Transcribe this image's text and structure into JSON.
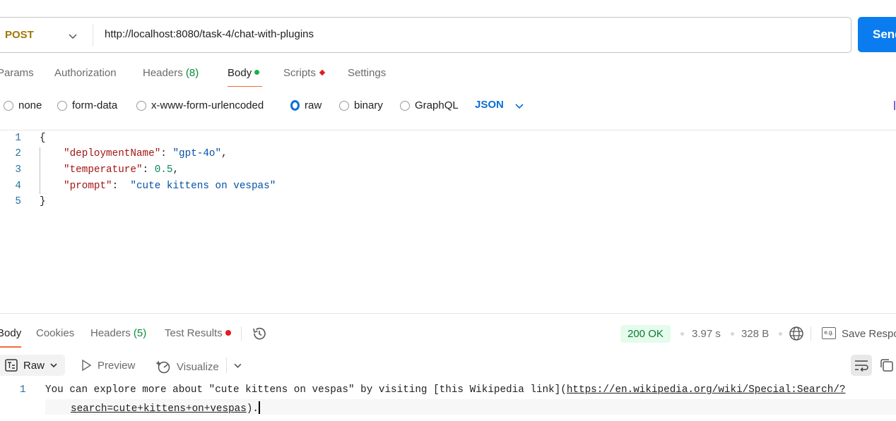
{
  "request": {
    "method": "POST",
    "url": "http://localhost:8080/task-4/chat-with-plugins",
    "send_label": "Send",
    "tabs": [
      {
        "label": "Params"
      },
      {
        "label": "Authorization"
      },
      {
        "label": "Headers",
        "count": "(8)"
      },
      {
        "label": "Body",
        "active": true,
        "indicator": "green-dot"
      },
      {
        "label": "Scripts",
        "indicator": "red-diamond"
      },
      {
        "label": "Settings"
      }
    ],
    "body_types": [
      "none",
      "form-data",
      "x-www-form-urlencoded",
      "raw",
      "binary",
      "GraphQL"
    ],
    "selected_body_type": "raw",
    "language": "JSON",
    "code_lines": [
      {
        "n": "1",
        "text": "{"
      },
      {
        "n": "2",
        "key": "\"deploymentName\"",
        "sep": ": ",
        "value": "\"gpt-4o\"",
        "tail": ","
      },
      {
        "n": "3",
        "key": "\"temperature\"",
        "sep": ": ",
        "value": "0.5",
        "tail": ","
      },
      {
        "n": "4",
        "key": "\"prompt\"",
        "sep": ":  ",
        "value": "\"cute kittens on vespas\"",
        "tail": ""
      },
      {
        "n": "5",
        "text": "}"
      }
    ]
  },
  "response": {
    "tabs": [
      {
        "label": "Body",
        "active": true
      },
      {
        "label": "Cookies"
      },
      {
        "label": "Headers",
        "count": "(5)"
      },
      {
        "label": "Test Results",
        "indicator": "red-dot"
      }
    ],
    "status": "200 OK",
    "time": "3.97 s",
    "size": "328 B",
    "save_label": "Save Response",
    "view_modes": {
      "raw": "Raw",
      "preview": "Preview",
      "visualize": "Visualize"
    },
    "line_number": "1",
    "text_before": "You can explore more about \"cute kittens on vespas\" by visiting [this Wikipedia link](",
    "link_part1": "https://en.wikipedia.org/wiki/Special:Search/?",
    "link_part2": "search=cute+kittens+on+vespas",
    "text_after": ")."
  },
  "colors": {
    "accent": "#0a7cf0",
    "method": "#a37607",
    "tab_underline": "#f26b3a",
    "status_ok": "#0c7a35"
  }
}
